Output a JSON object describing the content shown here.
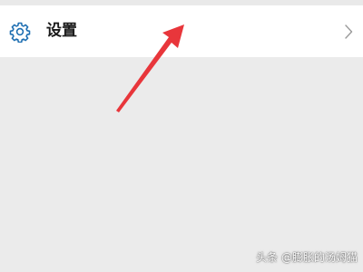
{
  "settings_row": {
    "label": "设置",
    "icon": "gear-icon",
    "trailing_icon": "chevron-right-icon",
    "icon_color": "#1f6fb2"
  },
  "annotation": {
    "arrow_color": "#e8363b"
  },
  "watermark": {
    "text": "头条 @膨胀的汤姆猫"
  },
  "colors": {
    "background": "#ebebeb",
    "row_background": "#ffffff",
    "chevron": "#9a9a9a"
  }
}
